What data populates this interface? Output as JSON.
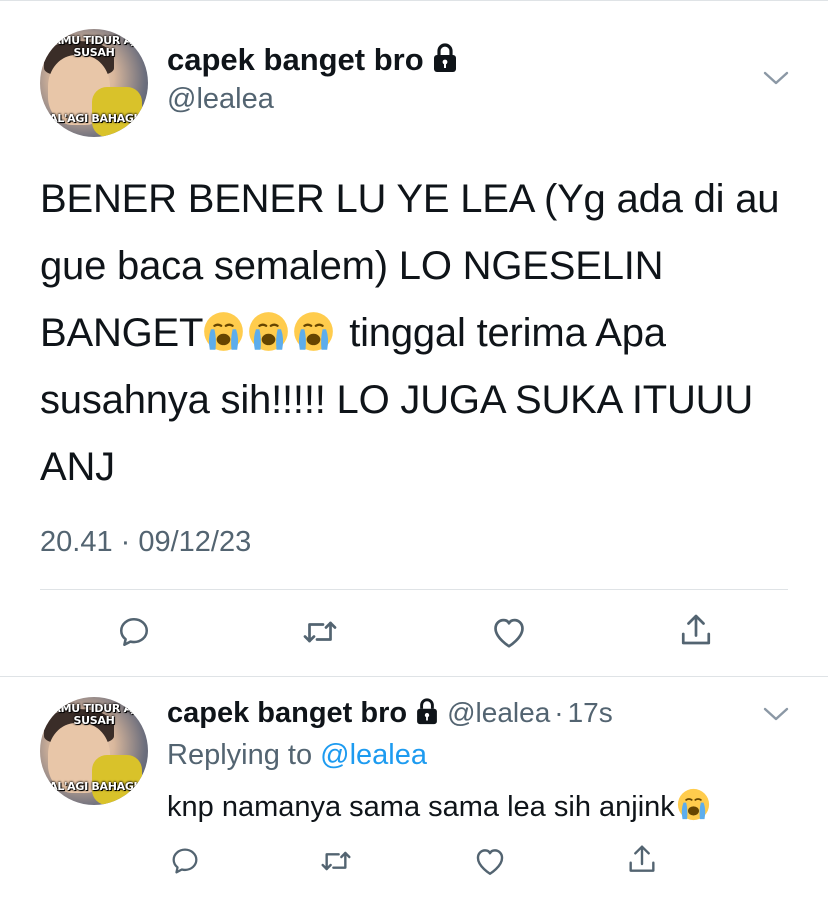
{
  "tweet": {
    "display_name": "capek banget bro",
    "handle": "@lealea",
    "avatar_caption_top": "KAMU TIDUR AJA SUSAH",
    "avatar_caption_bottom": "PAL'AGI BAHAGIA",
    "text_part1": "BENER BENER LU YE LEA (Yg ada di au gue baca semalem) LO NGESELIN BANGET",
    "text_part2": " tinggal terima Apa susahnya sih!!!!! LO JUGA SUKA ITUUU ANJ",
    "emoji_count": 3,
    "emoji_name": "loudly-crying-face",
    "timestamp": "20.41 · 09/12/23"
  },
  "reply": {
    "display_name": "capek banget bro",
    "handle": "@lealea",
    "separator": "·",
    "time_ago": "17s",
    "replying_prefix": "Replying to ",
    "replying_to": "@lealea",
    "text": "knp namanya sama sama lea sih anjink",
    "emoji_name": "loudly-crying-face"
  },
  "icons": {
    "reply": "reply-icon",
    "retweet": "retweet-icon",
    "like": "heart-icon",
    "share": "share-icon",
    "lock": "lock-icon",
    "more": "chevron-down-icon"
  },
  "colors": {
    "text": "#0f1419",
    "secondary": "#536471",
    "link": "#1d9bf0",
    "divider": "#dfe3e6",
    "emoji_face": "#ffcc4d",
    "emoji_tears": "#5dadec"
  }
}
